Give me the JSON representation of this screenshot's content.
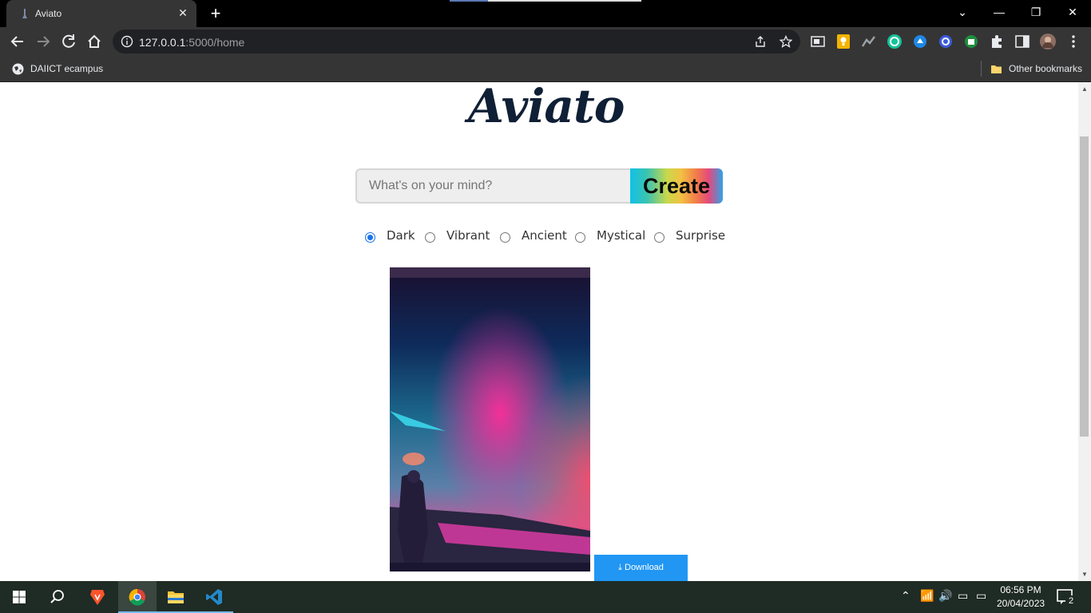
{
  "browser": {
    "tab": {
      "title": "Aviato"
    },
    "url": {
      "host": "127.0.0.1",
      "path": ":5000/home"
    },
    "bookmarks": [
      {
        "label": "DAIICT ecampus"
      },
      {
        "label": "Other bookmarks"
      }
    ]
  },
  "page": {
    "logo": "Aviato",
    "search": {
      "placeholder": "What's on your mind?",
      "value": ""
    },
    "create_label": "Create",
    "styles": [
      {
        "label": "Dark",
        "checked": true
      },
      {
        "label": "Vibrant",
        "checked": false
      },
      {
        "label": "Ancient",
        "checked": false
      },
      {
        "label": "Mystical",
        "checked": false
      },
      {
        "label": "Surprise",
        "checked": false
      }
    ],
    "download_label": "Download"
  },
  "taskbar": {
    "time": "06:56 PM",
    "date": "20/04/2023",
    "notifications": "2"
  },
  "colors": {
    "accent": "#2196f3",
    "chrome_dark": "#353535",
    "logo": "#0f1f35"
  }
}
